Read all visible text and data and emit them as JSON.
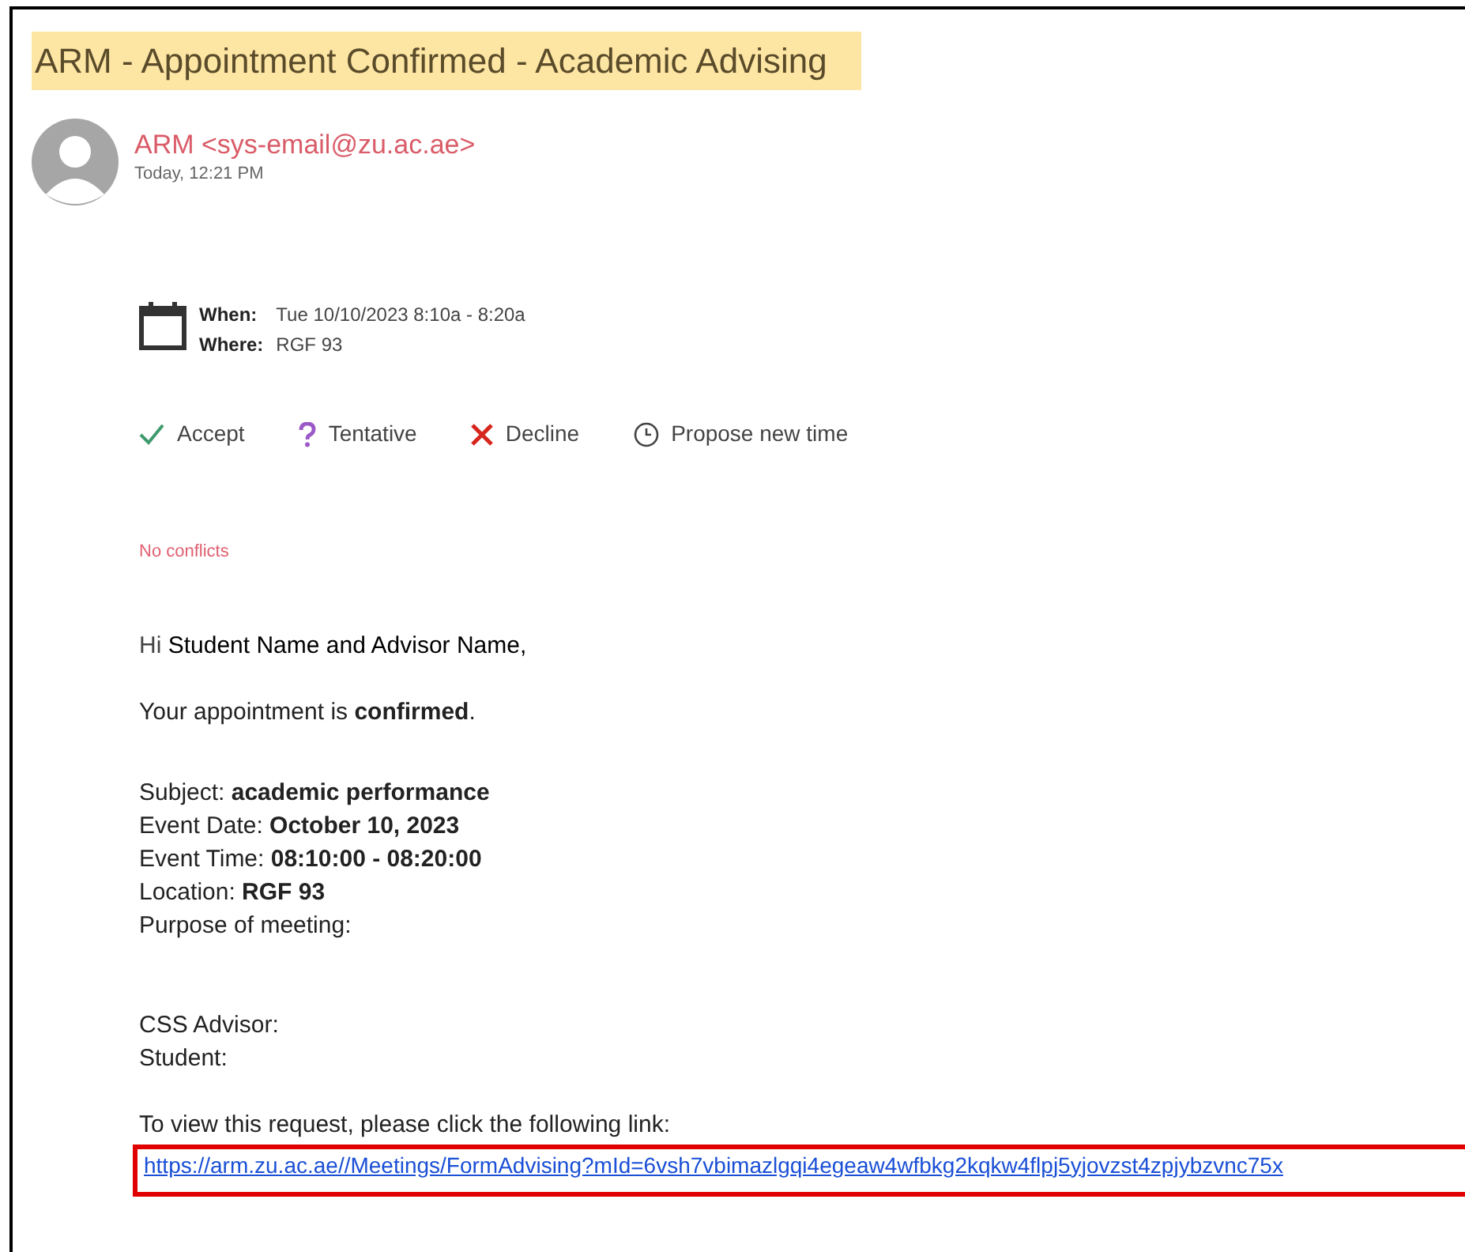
{
  "title": {
    "text": "ARM - Appointment Confirmed - Academic Advising",
    "highlighted": true
  },
  "sender": {
    "name": "ARM <sys-email@zu.ac.ae>",
    "time": "Today, 12:21 PM"
  },
  "meeting": {
    "when_label": "When:",
    "when": "Tue 10/10/2023 8:10a - 8:20a",
    "where_label": "Where:",
    "where": "RGF 93"
  },
  "actions": [
    {
      "kind": "accept",
      "label": "Accept"
    },
    {
      "kind": "tentative",
      "label": "Tentative"
    },
    {
      "kind": "decline",
      "label": "Decline"
    },
    {
      "kind": "propose",
      "label": "Propose new time"
    }
  ],
  "conflicts": "No conflicts",
  "greeting": {
    "salutation": "Hi",
    "names": "Student Name and Advisor Name,"
  },
  "confirmation": "Your appointment is **confirmed**.",
  "details": [
    "Subject: **academic performance**",
    "Event Date: **October 10, 2023**",
    "Event Time: **08:10:00 - 08:20:00**",
    "Location: **RGF 93**",
    "Purpose of meeting:"
  ],
  "people": [
    "CSS Advisor:",
    "Student:"
  ],
  "link_prompt": "To view this request, please click the following link:",
  "link": {
    "text": "https://arm.zu.ac.ae//Meetings/FormAdvising?mId=6vsh7vbimazlgqi4egeaw4wfbkg2kqkw4flpj5yjovzst4zpjybzvnc75x",
    "highlighted": true
  }
}
